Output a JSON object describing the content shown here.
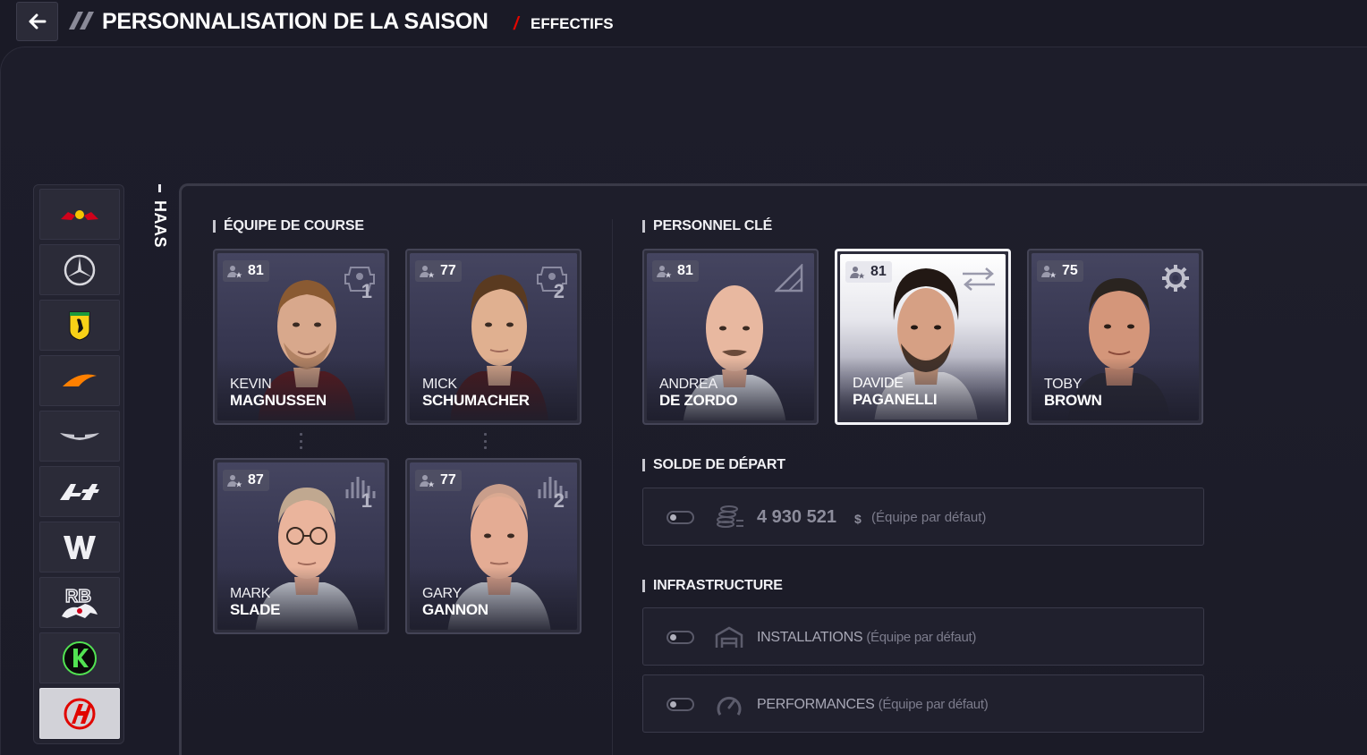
{
  "header": {
    "title": "PERSONNALISATION DE LA SAISON",
    "subtitle": "EFFECTIFS"
  },
  "team": {
    "name": "HAAS"
  },
  "sidebar": {
    "teams": [
      {
        "name": "Red Bull",
        "icon": "red-bull-logo-icon"
      },
      {
        "name": "Mercedes",
        "icon": "mercedes-logo-icon"
      },
      {
        "name": "Ferrari",
        "icon": "ferrari-logo-icon"
      },
      {
        "name": "McLaren",
        "icon": "mclaren-logo-icon"
      },
      {
        "name": "Aston Martin",
        "icon": "aston-martin-logo-icon"
      },
      {
        "name": "Alpine",
        "icon": "alpine-logo-icon"
      },
      {
        "name": "Williams",
        "icon": "williams-logo-icon"
      },
      {
        "name": "RB",
        "icon": "rb-logo-icon"
      },
      {
        "name": "Sauber",
        "icon": "sauber-logo-icon"
      },
      {
        "name": "Haas",
        "icon": "haas-logo-icon",
        "active": true
      }
    ]
  },
  "race_team": {
    "title": "ÉQUIPE DE COURSE",
    "drivers": [
      {
        "first": "KEVIN",
        "last": "MAGNUSSEN",
        "rating": "81",
        "number": "1",
        "role_icon": "driver-car-icon"
      },
      {
        "first": "MICK",
        "last": "SCHUMACHER",
        "rating": "77",
        "number": "2",
        "role_icon": "driver-car-icon"
      }
    ],
    "engineers": [
      {
        "first": "MARK",
        "last": "SLADE",
        "rating": "87",
        "number": "1",
        "role_icon": "race-engineer-icon"
      },
      {
        "first": "GARY",
        "last": "GANNON",
        "rating": "77",
        "number": "2",
        "role_icon": "race-engineer-icon"
      }
    ]
  },
  "key_staff": {
    "title": "PERSONNEL CLÉ",
    "members": [
      {
        "first": "ANDREA",
        "last": "DE ZORDO",
        "rating": "81",
        "role_icon": "technical-director-icon"
      },
      {
        "first": "DAVIDE",
        "last": "PAGANELLI",
        "rating": "81",
        "role_icon": "transfer-arrows-icon",
        "selected": true
      },
      {
        "first": "TOBY",
        "last": "BROWN",
        "rating": "75",
        "role_icon": "gear-icon"
      }
    ]
  },
  "starting_balance": {
    "title": "SOLDE DE DÉPART",
    "amount": "4 930 521",
    "currency": "$",
    "note": "(Équipe par défaut)"
  },
  "infrastructure": {
    "title": "INFRASTRUCTURE",
    "rows": [
      {
        "label": "INSTALLATIONS",
        "note": "(Équipe par défaut)",
        "icon": "facilities-icon"
      },
      {
        "label": "PERFORMANCES",
        "note": "(Équipe par défaut)",
        "icon": "gauge-icon"
      }
    ]
  },
  "colors": {
    "accent_red": "#e10600",
    "background": "#1a1a26"
  }
}
